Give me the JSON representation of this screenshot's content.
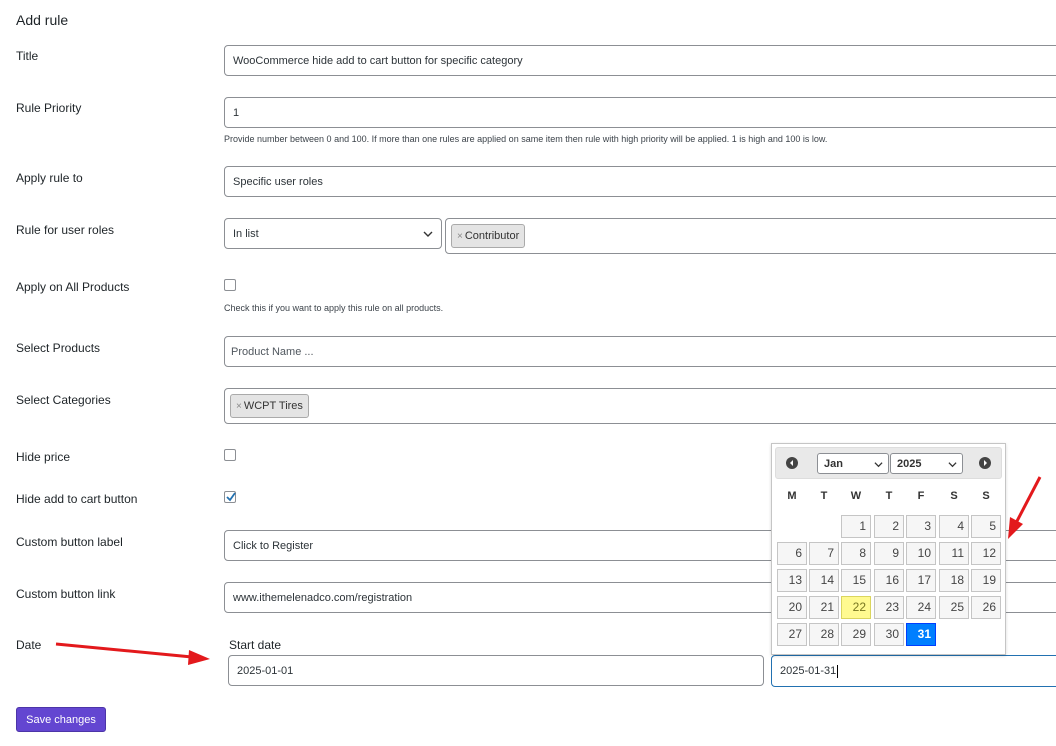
{
  "page": {
    "heading": "Add rule"
  },
  "title_field": {
    "label": "Title",
    "value": "WooCommerce hide add to cart button for specific category"
  },
  "priority_field": {
    "label": "Rule Priority",
    "value": "1",
    "help": "Provide number between 0 and 100. If more than one rules are applied on same item then rule with high priority will be applied. 1 is high and 100 is low."
  },
  "apply_rule_field": {
    "label": "Apply rule to",
    "value": "Specific user roles"
  },
  "user_roles_field": {
    "label": "Rule for user roles",
    "condition": "In list",
    "tags": [
      "Contributor"
    ]
  },
  "all_products_field": {
    "label": "Apply on All Products",
    "checked": false,
    "help": "Check this if you want to apply this rule on all products."
  },
  "select_products_field": {
    "label": "Select Products",
    "placeholder": "Product Name ..."
  },
  "select_categories_field": {
    "label": "Select Categories",
    "tags": [
      "WCPT Tires"
    ]
  },
  "hide_price_field": {
    "label": "Hide price",
    "checked": false
  },
  "hide_cart_field": {
    "label": "Hide add to cart button",
    "checked": true
  },
  "custom_label_field": {
    "label": "Custom button label",
    "value": "Click to Register"
  },
  "custom_link_field": {
    "label": "Custom button link",
    "value": "www.ithemelenadco.com/registration"
  },
  "date_field": {
    "label": "Date",
    "start_label": "Start date",
    "start_value": "2025-01-01",
    "end_value": "2025-01-31"
  },
  "datepicker": {
    "month": "Jan",
    "year": "2025",
    "weekdays": [
      "M",
      "T",
      "W",
      "T",
      "F",
      "S",
      "S"
    ],
    "first_weekday_index": 2,
    "days_in_month": 31,
    "today": 22,
    "selected": 31
  },
  "save_button": {
    "label": "Save changes"
  },
  "colors": {
    "primary": "#6346d1",
    "arrow": "#e3191c",
    "datepicker_active": "#007fff",
    "datepicker_today": "#fffa90"
  },
  "annotations": {
    "arrows": 2
  }
}
